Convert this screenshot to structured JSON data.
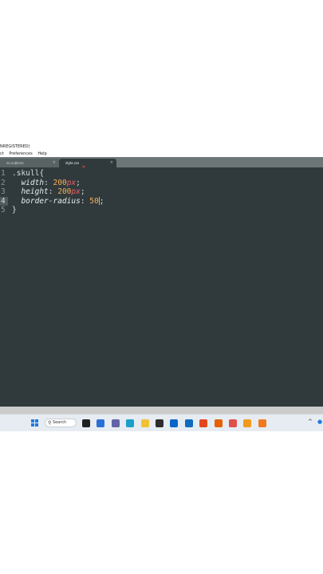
{
  "window": {
    "title": "NREGISTERED)"
  },
  "menu": [
    "ct",
    "Preferences",
    "Help"
  ],
  "tabs": [
    {
      "label": "ex.sublime",
      "active": false,
      "close": "×"
    },
    {
      "label": "style.css",
      "active": true,
      "close": "×"
    }
  ],
  "editor": {
    "line_numbers": [
      "1",
      "2",
      "3",
      "4",
      "5"
    ],
    "active_line": 4,
    "lines": [
      {
        "sel": ".skull{"
      },
      {
        "prop": "width",
        "colon": ": ",
        "num": "200",
        "unit": "px",
        "end": ";"
      },
      {
        "prop": "height",
        "colon": ": ",
        "num": "200",
        "unit": "px",
        "end": ";"
      },
      {
        "prop": "border-radius",
        "colon": ": ",
        "num": "50",
        "end": ";"
      },
      {
        "sel": "}"
      }
    ]
  },
  "taskbar": {
    "search_label": "Search",
    "search_icon": "magnifier-icon",
    "apps": [
      {
        "name": "task-view-icon",
        "color": "#202020"
      },
      {
        "name": "widgets-icon",
        "color": "#2b6fd6"
      },
      {
        "name": "chat-icon",
        "color": "#6264a7"
      },
      {
        "name": "edge-icon",
        "color": "#1ba0c9"
      },
      {
        "name": "file-explorer-icon",
        "color": "#f2c132"
      },
      {
        "name": "terminal-icon",
        "color": "#2d2d2d"
      },
      {
        "name": "mail-icon",
        "color": "#0a64c8"
      },
      {
        "name": "outlook-icon",
        "color": "#0f6cbd"
      },
      {
        "name": "office-icon",
        "color": "#e3461c"
      },
      {
        "name": "firefox-icon",
        "color": "#e66000"
      },
      {
        "name": "camera-icon",
        "color": "#e0504a"
      },
      {
        "name": "sublime-text-icon",
        "color": "#f29a1b"
      },
      {
        "name": "xampp-icon",
        "color": "#f27a1e"
      }
    ],
    "tray_chevron": "^"
  },
  "colors": {
    "editor_bg": "#303a3c",
    "number": "#f9ae58",
    "unit": "#ec5f66"
  }
}
